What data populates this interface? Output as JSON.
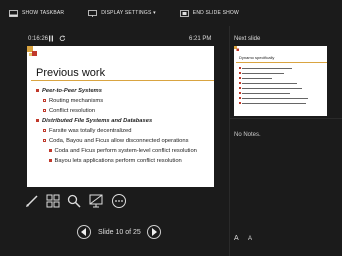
{
  "topbar": {
    "show_taskbar": "SHOW TASKBAR",
    "display_settings": "DISPLAY SETTINGS ▾",
    "end_slide_show": "END SLIDE SHOW"
  },
  "presenter": {
    "timer": "0:16:26",
    "clock": "6:21 PM"
  },
  "slide": {
    "title": "Previous work",
    "lines": [
      "Peer-to-Peer Systems",
      "Routing mechanisms",
      "Conflict resolution",
      "Distributed File Systems and Databases",
      "Farsite was totally decentralized",
      "Coda, Bayou and Ficus allow disconnected operations",
      "Coda and Ficus perform system-level conflict resolution",
      "Bayou lets applications perform conflict resolution"
    ]
  },
  "nav": {
    "counter": "Slide 10 of 25"
  },
  "next_slide": {
    "label": "Next slide",
    "thumb_title": "Dynamo specifically"
  },
  "notes": {
    "text": "No Notes."
  },
  "font_controls": {
    "increase": "A",
    "decrease": "A"
  },
  "colors": {
    "background": "#1b1b1b",
    "accent_bullet": "#c0392b",
    "slide_rule": "#d9a441"
  }
}
